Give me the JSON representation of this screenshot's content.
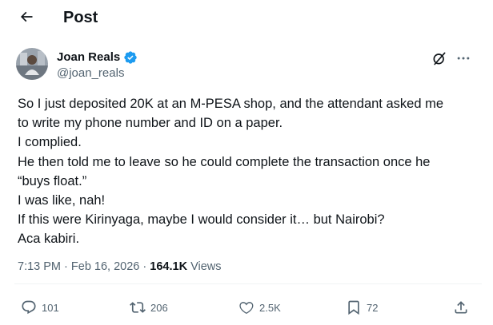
{
  "header": {
    "title": "Post",
    "back_icon": "back-arrow-icon"
  },
  "author": {
    "name": "Joan Reals",
    "handle": "@joan_reals",
    "verified_icon": "verified-badge-icon",
    "verified_color": "#1d9bf0"
  },
  "post": {
    "lines": [
      "So I just deposited 20K at an M-PESA shop, and the attendant asked me",
      "to write my phone number and ID on a paper.",
      "I complied.",
      "He then told me to leave so he could complete the transaction once he",
      "“buys float.”",
      "I was like, nah!",
      "If this were Kirinyaga, maybe I would consider it… but Nairobi?",
      "Aca kabiri."
    ]
  },
  "meta": {
    "time": "7:13 PM",
    "separator": "·",
    "date": "Feb 16, 2026",
    "views_count": "164.1K",
    "views_label": "Views"
  },
  "actions": {
    "replies": "101",
    "reposts": "206",
    "likes": "2.5K",
    "bookmarks": "72"
  },
  "colors": {
    "text": "#0f1419",
    "secondary": "#536471",
    "accent": "#1d9bf0",
    "divider": "#eff3f4"
  }
}
